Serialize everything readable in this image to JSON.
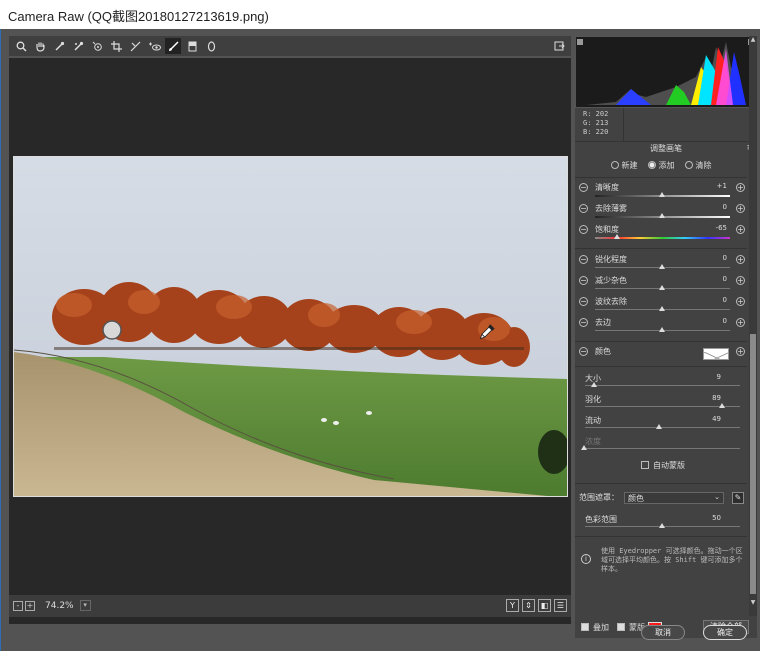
{
  "window": {
    "title": "Camera Raw (QQ截图20180127213619.png)"
  },
  "toolbar": {
    "tools": [
      {
        "icon": "zoom-icon",
        "glyph": "🔍"
      },
      {
        "icon": "hand-icon",
        "glyph": "✋"
      },
      {
        "icon": "white-balance-icon",
        "glyph": "✎"
      },
      {
        "icon": "color-sampler-icon",
        "glyph": "✎"
      },
      {
        "icon": "targeted-adjustment-icon",
        "glyph": "◎"
      },
      {
        "icon": "crop-icon",
        "glyph": "⌗"
      },
      {
        "icon": "spot-removal-icon",
        "glyph": "✂"
      },
      {
        "icon": "red-eye-icon",
        "glyph": "◉"
      },
      {
        "icon": "adjustment-brush-icon",
        "glyph": "🖌",
        "active": true
      },
      {
        "icon": "graduated-filter-icon",
        "glyph": "▮"
      },
      {
        "icon": "radial-filter-icon",
        "glyph": "◯"
      }
    ]
  },
  "status": {
    "zoom": "74.2%",
    "zoom_minus": "-",
    "zoom_plus": "+",
    "view_buttons": [
      "Y",
      "⇕",
      "◧",
      "☰"
    ]
  },
  "histogram": {
    "r": "R:  202",
    "g": "G:  213",
    "b": "B:  220"
  },
  "panel": {
    "title": "调整画笔",
    "menu": "≡",
    "modes": [
      {
        "label": "新建",
        "selected": false
      },
      {
        "label": "添加",
        "selected": true
      },
      {
        "label": "清除",
        "selected": false
      }
    ],
    "sliders": [
      {
        "label": "清晰度",
        "value": "+1"
      },
      {
        "label": "去除薄雾",
        "value": "0"
      },
      {
        "label": "饱和度",
        "value": "-65"
      },
      {
        "label": "锐化程度",
        "value": "0"
      },
      {
        "label": "减少杂色",
        "value": "0"
      },
      {
        "label": "波纹去除",
        "value": "0"
      },
      {
        "label": "去边",
        "value": "0"
      }
    ],
    "color_label": "颜色",
    "brush": [
      {
        "label": "大小",
        "value": "9"
      },
      {
        "label": "羽化",
        "value": "89"
      },
      {
        "label": "流动",
        "value": "49"
      },
      {
        "label": "浓度",
        "value": ""
      }
    ],
    "auto_mask": "自动蒙版",
    "range_mask_label": "范围遮罩：",
    "range_mask_value": "颜色",
    "color_range_label": "色彩范围",
    "color_range_value": "50",
    "info_text": "使用 Eyedropper 可选择颜色。拖动一个区域可选择平均颜色。按 Shift 键可添加多个样本。"
  },
  "panel_footer": {
    "overlay_label": "叠加",
    "mask_label": "蒙版",
    "mask_color": "#ff1a1a",
    "clear_all": "清除全部"
  },
  "dialog": {
    "cancel": "取消",
    "ok": "确定"
  }
}
